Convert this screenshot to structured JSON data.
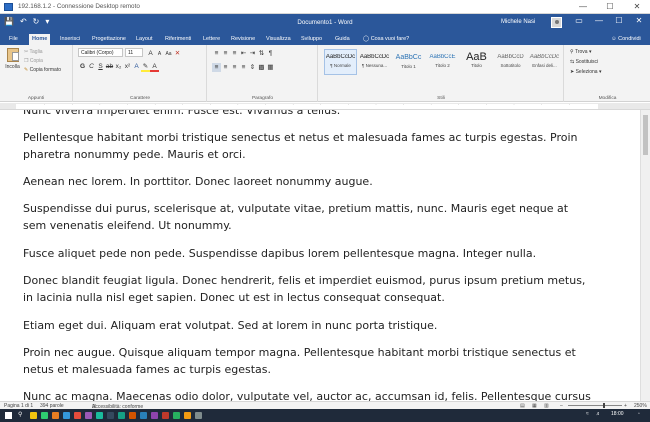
{
  "remote_window": {
    "title": "192.168.1.2 - Connessione Desktop remoto",
    "controls": [
      "—",
      "☐",
      "✕"
    ]
  },
  "word": {
    "qat": [
      "💾",
      "↶",
      "↻",
      "▾"
    ],
    "document_title": "Documento1 - Word",
    "user_name": "Michele Nasi",
    "window_controls": [
      "▭",
      "—",
      "☐",
      "✕"
    ],
    "tabs": [
      "File",
      "Home",
      "Inserisci",
      "Progettazione",
      "Layout",
      "Riferimenti",
      "Lettere",
      "Revisione",
      "Visualizza",
      "Sviluppo",
      "Guida"
    ],
    "active_tab": "Home",
    "tell_me": "Cosa vuoi fare?",
    "share": "Condividi",
    "ribbon": {
      "clipboard": {
        "paste": "Incolla",
        "cut": "Taglia",
        "copy": "Copia",
        "format_painter": "Copia formato",
        "label": "Appunti"
      },
      "font": {
        "family": "Calibri (Corpo)",
        "size": "11",
        "label": "Carattere"
      },
      "paragraph": {
        "label": "Paragrafo"
      },
      "styles": {
        "items": [
          {
            "preview": "AaBbCcDc",
            "name": "¶ Normale"
          },
          {
            "preview": "AaBbCcDc",
            "name": "¶ Nessuna..."
          },
          {
            "preview": "AaBbCc",
            "name": "Titolo 1"
          },
          {
            "preview": "AaBbCcE",
            "name": "Titolo 2"
          },
          {
            "preview": "AaB",
            "name": "Titolo"
          },
          {
            "preview": "AaBbCcD",
            "name": "Sottotitolo"
          },
          {
            "preview": "AaBbCcDc",
            "name": "Enfasi deli..."
          }
        ],
        "label": "Stili"
      },
      "editing": {
        "find": "Trova",
        "replace": "Sostituisci",
        "select": "Seleziona",
        "label": "Modifica"
      }
    },
    "document": {
      "paragraphs": [
        "Nunc viverra imperdiet enim. Fusce est. Vivamus a tellus.",
        "Pellentesque habitant morbi tristique senectus et netus et malesuada fames ac turpis egestas. Proin pharetra nonummy pede. Mauris et orci.",
        "Aenean nec lorem. In porttitor. Donec laoreet nonummy augue.",
        "Suspendisse dui purus, scelerisque at, vulputate vitae, pretium mattis, nunc. Mauris eget neque at sem venenatis eleifend. Ut nonummy.",
        "Fusce aliquet pede non pede. Suspendisse dapibus lorem pellentesque magna. Integer nulla.",
        "Donec blandit feugiat ligula. Donec hendrerit, felis et imperdiet euismod, purus ipsum pretium metus, in lacinia nulla nisl eget sapien. Donec ut est in lectus consequat consequat.",
        "Etiam eget dui. Aliquam erat volutpat. Sed at lorem in nunc porta tristique.",
        "Proin nec augue. Quisque aliquam tempor magna. Pellentesque habitant morbi tristique senectus et netus et malesuada fames ac turpis egestas.",
        "Nunc ac magna. Maecenas odio dolor, vulputate vel, auctor ac, accumsan id, felis. Pellentesque cursus"
      ]
    },
    "status_bar": {
      "page": "Pagina 1 di 1",
      "words": "394 parole",
      "accessibility": "Accessibilità: conforme",
      "zoom": "250%"
    }
  },
  "taskbar": {
    "time": "18:00",
    "colors": [
      "#f1c40f",
      "#2ecc71",
      "#e67e22",
      "#3498db",
      "#e74c3c",
      "#9b59b6",
      "#1abc9c",
      "#34495e",
      "#16a085",
      "#d35400",
      "#2980b9",
      "#8e44ad",
      "#c0392b",
      "#27ae60",
      "#f39c12",
      "#7f8c8d"
    ]
  },
  "colors": {
    "word_blue": "#2b579a",
    "ribbon_bg": "#f3f3f3",
    "taskbar_bg": "#1f2a3a"
  }
}
